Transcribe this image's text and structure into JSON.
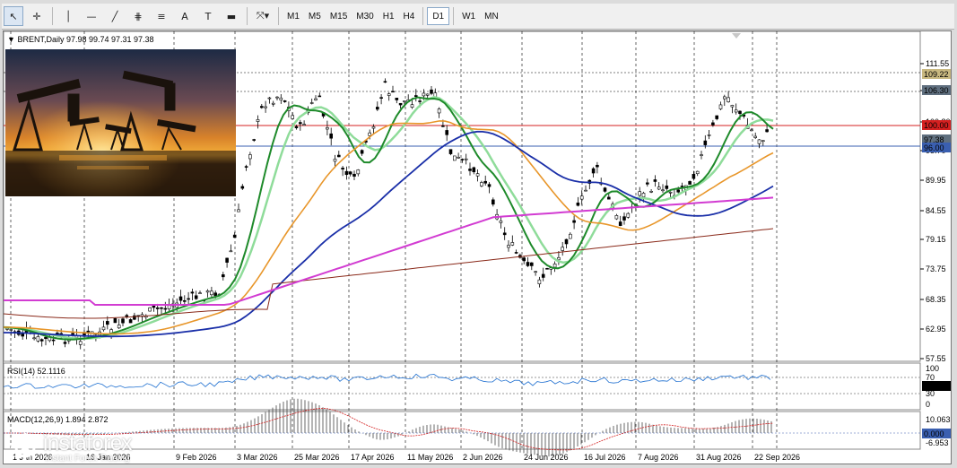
{
  "toolbar": {
    "tools": [
      {
        "name": "cursor-tool-icon",
        "glyph": "↖"
      },
      {
        "name": "crosshair-tool-icon",
        "glyph": "✛"
      },
      {
        "name": "vertical-line-tool-icon",
        "glyph": "│"
      },
      {
        "name": "horizontal-line-tool-icon",
        "glyph": "—"
      },
      {
        "name": "trendline-tool-icon",
        "glyph": "╱"
      },
      {
        "name": "channel-tool-icon",
        "glyph": "⋕"
      },
      {
        "name": "fibonacci-tool-icon",
        "glyph": "≡"
      },
      {
        "name": "text-tool-icon",
        "glyph": "A"
      },
      {
        "name": "text-label-tool-icon",
        "glyph": "T"
      },
      {
        "name": "rectangle-tool-icon",
        "glyph": "▬"
      },
      {
        "name": "shapes-dropdown-icon",
        "glyph": "⤧▾"
      }
    ],
    "timeframes": [
      "M1",
      "M5",
      "M15",
      "M30",
      "H1",
      "H4",
      "D1",
      "W1",
      "MN"
    ],
    "selected_timeframe": "D1"
  },
  "chart": {
    "header_symbol": "BRENT,Daily",
    "header_values": "97.98 99.74 97.31 97.38",
    "rsi_label": "RSI(14) 52.1116",
    "macd_label": "MACD(12,26,9) 1.894 2.872",
    "price_ticks": [
      "111.55",
      "106.30",
      "100.80",
      "95.70",
      "89.95",
      "84.55",
      "79.15",
      "73.75",
      "68.35",
      "62.95",
      "57.55"
    ],
    "price_badges": [
      {
        "text": "109.22",
        "color": "#c8b880"
      },
      {
        "text": "106.30",
        "color": "#5f6f7f"
      },
      {
        "text": "100.00",
        "color": "#d42020"
      },
      {
        "text": "97.38",
        "color": "#5f6f7f"
      },
      {
        "text": "96.00",
        "color": "#3a5fb0"
      }
    ],
    "rsi_ticks": [
      "100",
      "70",
      "30",
      "0"
    ],
    "rsi_badge": "50.0000",
    "macd_ticks": [
      "10.063",
      "-6.953"
    ],
    "macd_badge": "0.000",
    "date_labels": [
      "1 Jan 2026",
      "16 Jan 2026",
      "9 Feb 2026",
      "3 Mar 2026",
      "25 Mar 2026",
      "17 Apr 2026",
      "11 May 2026",
      "2 Jun 2026",
      "24 Jun 2026",
      "16 Jul 2026",
      "7 Aug 2026",
      "31 Aug 2026",
      "22 Sep 2026"
    ]
  },
  "brand": {
    "name": "instaforex",
    "tagline": "Instant Forex Trading"
  },
  "colors": {
    "ma_fast": "#1e8a2a",
    "ma_fast_light": "#8fdc9a",
    "ma_mid": "#e8962a",
    "ma_blue": "#1a2fa8",
    "ma_magenta": "#d23cd2",
    "ma_brown": "#8a2a1a",
    "level_red": "#d42020",
    "level_blue": "#3a5fb0"
  }
}
